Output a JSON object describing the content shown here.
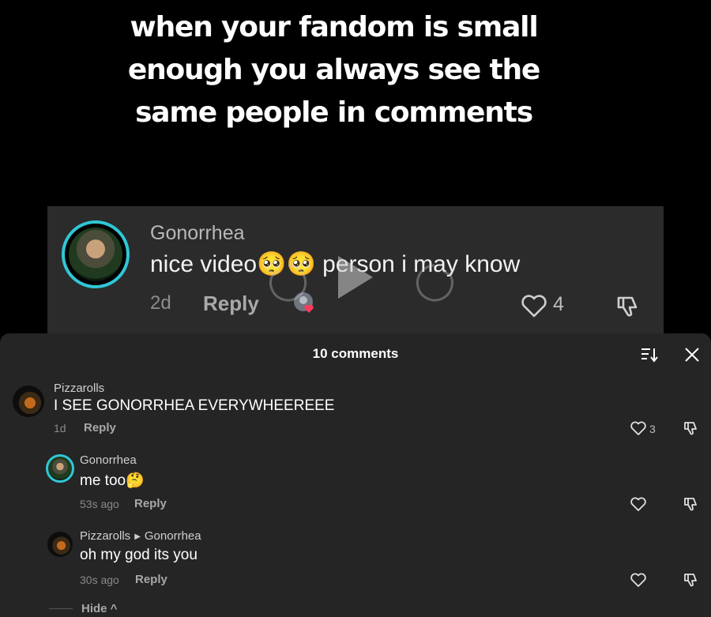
{
  "caption": {
    "lines": [
      "when your fandom is small",
      "enough you always see the",
      "same people in comments"
    ]
  },
  "video_comment": {
    "username": "Gonorrhea",
    "text": "nice video🥺🥺 person i may know",
    "time": "2d",
    "reply_label": "Reply",
    "likes": "4"
  },
  "sheet": {
    "title": "10 comments",
    "comments": [
      {
        "username": "Pizzarolls",
        "text": "I SEE GONORRHEA EVERYWHEEREEE",
        "time": "1d",
        "reply_label": "Reply",
        "likes": "3"
      },
      {
        "username": "Gonorrhea",
        "text": "me too🤔",
        "time": "53s ago",
        "reply_label": "Reply",
        "likes": ""
      },
      {
        "username": "Pizzarolls",
        "reply_to": "Gonorrhea",
        "text": "oh my god its you",
        "time": "30s ago",
        "reply_label": "Reply",
        "likes": ""
      }
    ],
    "hide_label": "Hide ^"
  },
  "colors": {
    "background": "#000000",
    "sheet": "#252525",
    "card": "#2b2b2b",
    "avatar_ring": "#2fc7d6"
  },
  "icons": [
    "heart-icon",
    "dislike-icon",
    "sort-icon",
    "close-icon",
    "play-icon",
    "rewind-icon",
    "forward-icon"
  ]
}
